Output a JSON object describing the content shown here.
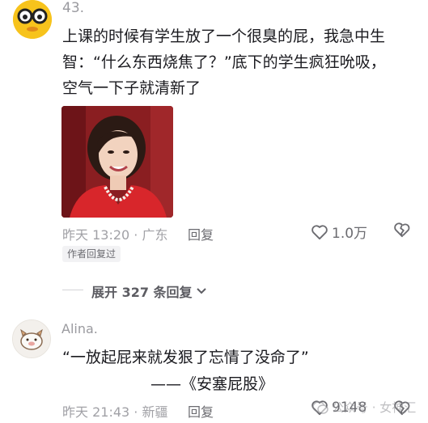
{
  "comment1": {
    "index": "43.",
    "text_lines": [
      "上课的时候有学生放了一个很臭的屁，我急中生",
      "智：“什么东西烧焦了？”底下的学生疯狂吮吸，",
      "空气一下子就清新了"
    ],
    "meta": "昨天 13:20 · 广东",
    "reply_label": "回复",
    "like_count": "1.0万",
    "author_badge": "作者回复过"
  },
  "expand_replies": "展开 327 条回复",
  "comment2": {
    "username": "Alina.",
    "text_line1": "“一放起屁来就发狠了忘情了没命了”",
    "text_line2": "——《安塞屁股》",
    "meta": "昨天 21:43 · 新疆",
    "reply_label": "回复",
    "like_count": "9148"
  },
  "watermark": "公众号 · 女神汇",
  "colors": {
    "avatar1_bg": "#f7c31c",
    "photo_bg": "#8a1e21",
    "jacket": "#d8262b"
  }
}
